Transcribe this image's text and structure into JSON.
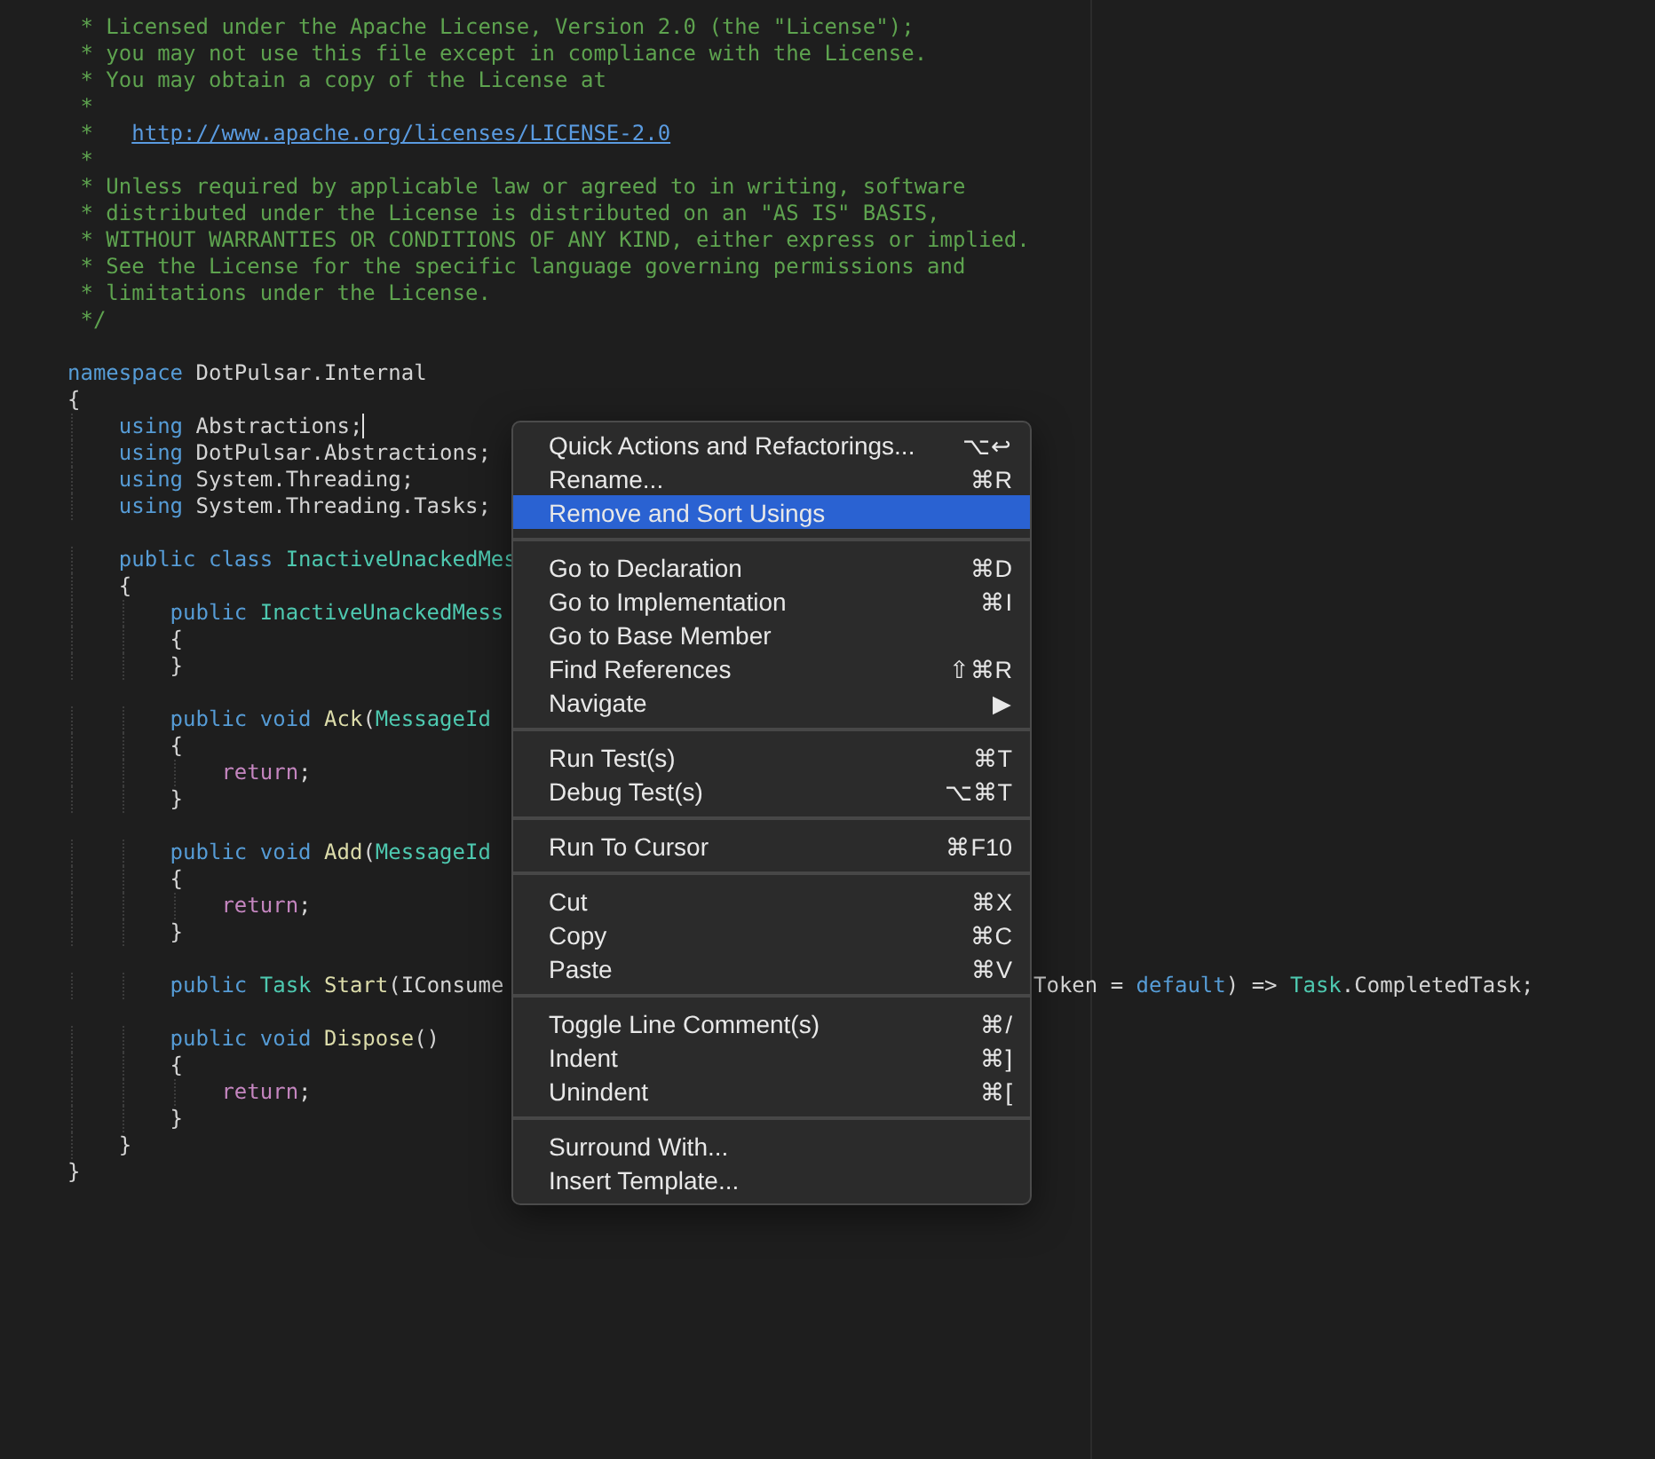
{
  "editor": {
    "lines": [
      {
        "tokens": [
          {
            "text": " * Licensed under the Apache License, Version 2.0 (the \"License\");",
            "kind": "comment"
          }
        ]
      },
      {
        "tokens": [
          {
            "text": " * you may not use this file except in compliance with the License.",
            "kind": "comment"
          }
        ]
      },
      {
        "tokens": [
          {
            "text": " * You may obtain a copy of the License at",
            "kind": "comment"
          }
        ]
      },
      {
        "tokens": [
          {
            "text": " *",
            "kind": "comment"
          }
        ]
      },
      {
        "tokens": [
          {
            "text": " *   ",
            "kind": "comment"
          },
          {
            "text": "http://www.apache.org/licenses/LICENSE-2.0",
            "kind": "link"
          }
        ]
      },
      {
        "tokens": [
          {
            "text": " *",
            "kind": "comment"
          }
        ]
      },
      {
        "tokens": [
          {
            "text": " * Unless required by applicable law or agreed to in writing, software",
            "kind": "comment"
          }
        ]
      },
      {
        "tokens": [
          {
            "text": " * distributed under the License is distributed on an \"AS IS\" BASIS,",
            "kind": "comment"
          }
        ]
      },
      {
        "tokens": [
          {
            "text": " * WITHOUT WARRANTIES OR CONDITIONS OF ANY KIND, either express or implied.",
            "kind": "comment"
          }
        ]
      },
      {
        "tokens": [
          {
            "text": " * See the License for the specific language governing permissions and",
            "kind": "comment"
          }
        ]
      },
      {
        "tokens": [
          {
            "text": " * limitations under the License.",
            "kind": "comment"
          }
        ]
      },
      {
        "tokens": [
          {
            "text": " */",
            "kind": "comment"
          }
        ]
      },
      {
        "kind": "blank"
      },
      {
        "tokens": [
          {
            "text": "namespace",
            "kind": "keyword"
          },
          {
            "text": " DotPulsar.Internal",
            "kind": "plain"
          }
        ]
      },
      {
        "tokens": [
          {
            "text": "{",
            "kind": "plain"
          }
        ]
      },
      {
        "tokens": [
          {
            "text": "    using",
            "kind": "keyword"
          },
          {
            "text": " Abstractions;",
            "kind": "plain",
            "caret": true
          }
        ]
      },
      {
        "tokens": [
          {
            "text": "    using",
            "kind": "keyword"
          },
          {
            "text": " DotPulsar.Abstractions;",
            "kind": "plain"
          }
        ]
      },
      {
        "tokens": [
          {
            "text": "    using",
            "kind": "keyword"
          },
          {
            "text": " System.Threading;",
            "kind": "plain"
          }
        ]
      },
      {
        "tokens": [
          {
            "text": "    using",
            "kind": "keyword"
          },
          {
            "text": " System.Threading.Tasks;",
            "kind": "plain"
          }
        ]
      },
      {
        "kind": "blank"
      },
      {
        "tokens": [
          {
            "text": "    public class",
            "kind": "keyword"
          },
          {
            "text": " InactiveUnackedMes",
            "kind": "type"
          }
        ]
      },
      {
        "tokens": [
          {
            "text": "    {",
            "kind": "plain"
          }
        ]
      },
      {
        "tokens": [
          {
            "text": "        public",
            "kind": "keyword"
          },
          {
            "text": " InactiveUnackedMess",
            "kind": "type"
          }
        ]
      },
      {
        "tokens": [
          {
            "text": "        {",
            "kind": "plain"
          }
        ]
      },
      {
        "tokens": [
          {
            "text": "        }",
            "kind": "plain"
          }
        ]
      },
      {
        "kind": "blank"
      },
      {
        "tokens": [
          {
            "text": "        public void",
            "kind": "keyword"
          },
          {
            "text": " Ack",
            "kind": "method"
          },
          {
            "text": "(",
            "kind": "plain"
          },
          {
            "text": "MessageId",
            "kind": "type"
          }
        ]
      },
      {
        "tokens": [
          {
            "text": "        {",
            "kind": "plain"
          }
        ]
      },
      {
        "tokens": [
          {
            "text": "            return",
            "kind": "control"
          },
          {
            "text": ";",
            "kind": "plain"
          }
        ]
      },
      {
        "tokens": [
          {
            "text": "        }",
            "kind": "plain"
          }
        ]
      },
      {
        "kind": "blank"
      },
      {
        "tokens": [
          {
            "text": "        public void",
            "kind": "keyword"
          },
          {
            "text": " Add",
            "kind": "method"
          },
          {
            "text": "(",
            "kind": "plain"
          },
          {
            "text": "MessageId",
            "kind": "type"
          }
        ]
      },
      {
        "tokens": [
          {
            "text": "        {",
            "kind": "plain"
          }
        ]
      },
      {
        "tokens": [
          {
            "text": "            return",
            "kind": "control"
          },
          {
            "text": ";",
            "kind": "plain"
          }
        ]
      },
      {
        "tokens": [
          {
            "text": "        }",
            "kind": "plain"
          }
        ]
      },
      {
        "kind": "blank"
      },
      {
        "tokens": [
          {
            "text": "        public",
            "kind": "keyword"
          },
          {
            "text": " Task",
            "kind": "type"
          },
          {
            "text": " Start",
            "kind": "method"
          },
          {
            "text": "(IConsume",
            "kind": "plain"
          }
        ],
        "tail": [
          {
            "text": "Token = ",
            "kind": "plain"
          },
          {
            "text": "default",
            "kind": "keyword"
          },
          {
            "text": ") => ",
            "kind": "plain"
          },
          {
            "text": "Task",
            "kind": "type"
          },
          {
            "text": ".CompletedTask;",
            "kind": "plain"
          }
        ]
      },
      {
        "kind": "blank"
      },
      {
        "tokens": [
          {
            "text": "        public void",
            "kind": "keyword"
          },
          {
            "text": " Dispose",
            "kind": "method"
          },
          {
            "text": "()",
            "kind": "plain"
          }
        ]
      },
      {
        "tokens": [
          {
            "text": "        {",
            "kind": "plain"
          }
        ]
      },
      {
        "tokens": [
          {
            "text": "            return",
            "kind": "control"
          },
          {
            "text": ";",
            "kind": "plain"
          }
        ]
      },
      {
        "tokens": [
          {
            "text": "        }",
            "kind": "plain"
          }
        ]
      },
      {
        "tokens": [
          {
            "text": "    }",
            "kind": "plain"
          }
        ]
      },
      {
        "tokens": [
          {
            "text": "}",
            "kind": "plain"
          }
        ]
      }
    ]
  },
  "context_menu": {
    "groups": [
      [
        {
          "label": "Quick Actions and Refactorings...",
          "shortcut": "⌥↩",
          "selected": false
        },
        {
          "label": "Rename...",
          "shortcut": "⌘R",
          "selected": false
        },
        {
          "label": "Remove and Sort Usings",
          "selected": true
        }
      ],
      [
        {
          "label": "Go to Declaration",
          "shortcut": "⌘D",
          "selected": false
        },
        {
          "label": "Go to Implementation",
          "shortcut": "⌘I",
          "selected": false
        },
        {
          "label": "Go to Base Member",
          "selected": false
        },
        {
          "label": "Find References",
          "shortcut": "⇧⌘R",
          "selected": false
        },
        {
          "label": "Navigate",
          "shortcut": "▶",
          "selected": false
        }
      ],
      [
        {
          "label": "Run Test(s)",
          "shortcut": "⌘T",
          "selected": false
        },
        {
          "label": "Debug Test(s)",
          "shortcut": "⌥⌘T",
          "selected": false
        }
      ],
      [
        {
          "label": "Run To Cursor",
          "shortcut": "⌘F10",
          "selected": false
        }
      ],
      [
        {
          "label": "Cut",
          "shortcut": "⌘X",
          "selected": false
        },
        {
          "label": "Copy",
          "shortcut": "⌘C",
          "selected": false
        },
        {
          "label": "Paste",
          "shortcut": "⌘V",
          "selected": false
        }
      ],
      [
        {
          "label": "Toggle Line Comment(s)",
          "shortcut": "⌘/",
          "selected": false
        },
        {
          "label": "Indent",
          "shortcut": "⌘]",
          "selected": false
        },
        {
          "label": "Unindent",
          "shortcut": "⌘[",
          "selected": false
        }
      ],
      [
        {
          "label": "Surround With...",
          "selected": false
        },
        {
          "label": "Insert Template...",
          "selected": false
        }
      ]
    ]
  }
}
